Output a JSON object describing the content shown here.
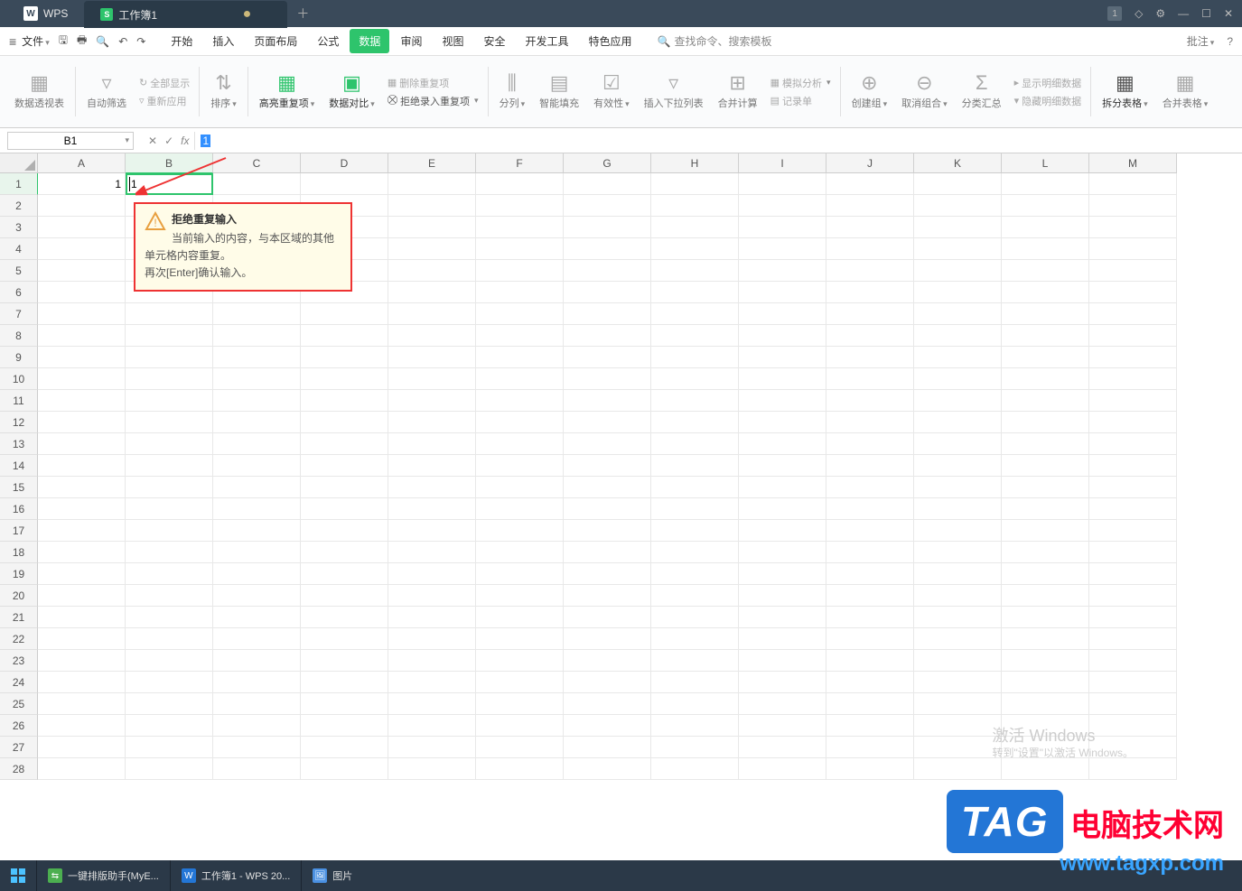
{
  "title": {
    "app": "WPS",
    "doc": "工作簿1"
  },
  "window": {
    "badge": "1"
  },
  "menubar": {
    "file": "文件",
    "tabs": [
      "开始",
      "插入",
      "页面布局",
      "公式",
      "数据",
      "审阅",
      "视图",
      "安全",
      "开发工具",
      "特色应用"
    ],
    "active_tab": "数据",
    "search_prompt": "查找命令、搜索模板",
    "annotate": "批注"
  },
  "ribbon": {
    "pivot": "数据透视表",
    "autofilter": "自动筛选",
    "showall": "全部显示",
    "reapply": "重新应用",
    "sort": "排序",
    "highlight_dup": "高亮重复项",
    "data_compare": "数据对比",
    "del_dup": "删除重复项",
    "reject_dup": "拒绝录入重复项",
    "split": "分列",
    "smartfill": "智能填充",
    "validation": "有效性",
    "dropdown": "插入下拉列表",
    "consolidate": "合并计算",
    "whatif": "模拟分析",
    "form": "记录单",
    "group": "创建组",
    "ungroup": "取消组合",
    "subtotal": "分类汇总",
    "showdetail": "显示明细数据",
    "hidedetail": "隐藏明细数据",
    "splittable": "拆分表格",
    "mergetable": "合并表格"
  },
  "formula_bar": {
    "name": "B1",
    "value": "1"
  },
  "columns": [
    "A",
    "B",
    "C",
    "D",
    "E",
    "F",
    "G",
    "H",
    "I",
    "J",
    "K",
    "L",
    "M"
  ],
  "rows": [
    1,
    2,
    3,
    4,
    5,
    6,
    7,
    8,
    9,
    10,
    11,
    12,
    13,
    14,
    15,
    16,
    17,
    18,
    19,
    20,
    21,
    22,
    23,
    24,
    25,
    26,
    27,
    28
  ],
  "cells": {
    "A1": "1",
    "B1_editing": "1"
  },
  "active": {
    "col": "B",
    "row": 1
  },
  "tooltip": {
    "title": "拒绝重复输入",
    "line1": "当前输入的内容，与本区域的其他单元格内容重复。",
    "line2": "再次[Enter]确认输入。"
  },
  "watermark": {
    "title": "激活 Windows",
    "sub": "转到\"设置\"以激活 Windows。"
  },
  "tag": {
    "logo": "TAG",
    "cn": "电脑技术网",
    "url": "www.tagxp.com"
  },
  "taskbar": {
    "items": [
      {
        "label": "一键排版助手(MyE...",
        "color": "#4caf50"
      },
      {
        "label": "工作簿1 - WPS 20...",
        "color": "#2376d6"
      },
      {
        "label": "图片",
        "color": "#4a90e2"
      }
    ]
  }
}
